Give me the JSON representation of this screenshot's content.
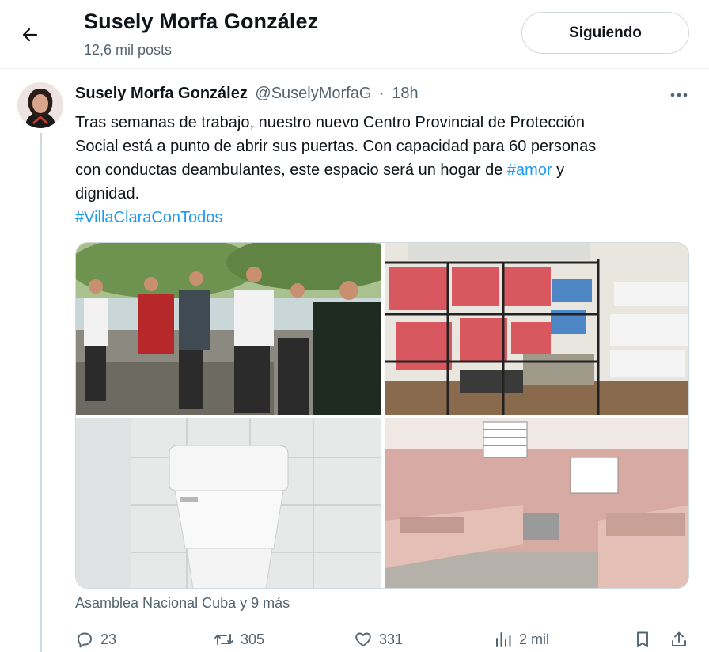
{
  "header": {
    "title": "Susely Morfa González",
    "post_count": "12,6 mil posts",
    "follow_label": "Siguiendo"
  },
  "tweet": {
    "author_name": "Susely Morfa González",
    "handle": "@SuselyMorfaG",
    "separator": "·",
    "time": "18h",
    "text_line1": "Tras semanas de trabajo, nuestro nuevo Centro Provincial de Protección",
    "text_line2": "Social está a punto de abrir sus puertas. Con capacidad para 60 personas",
    "text_line3_pre": "con conductas deambulantes, este espacio será un hogar de ",
    "text_line3_tag": "#amor",
    "text_line3_post": " y",
    "text_line4": "dignidad.",
    "hashtag": "#VillaClaraConTodos",
    "tagged": "Asamblea Nacional Cuba y 9 más"
  },
  "actions": {
    "replies": "23",
    "reposts": "305",
    "likes": "331",
    "views": "2 mil"
  },
  "icons": [
    "back-arrow-icon",
    "more-icon",
    "reply-icon",
    "repost-icon",
    "like-icon",
    "views-icon",
    "bookmark-icon",
    "share-icon"
  ],
  "colors": {
    "accent": "#1d9bf0",
    "muted": "#536471",
    "text": "#0f1419",
    "border": "#cfd9de"
  }
}
